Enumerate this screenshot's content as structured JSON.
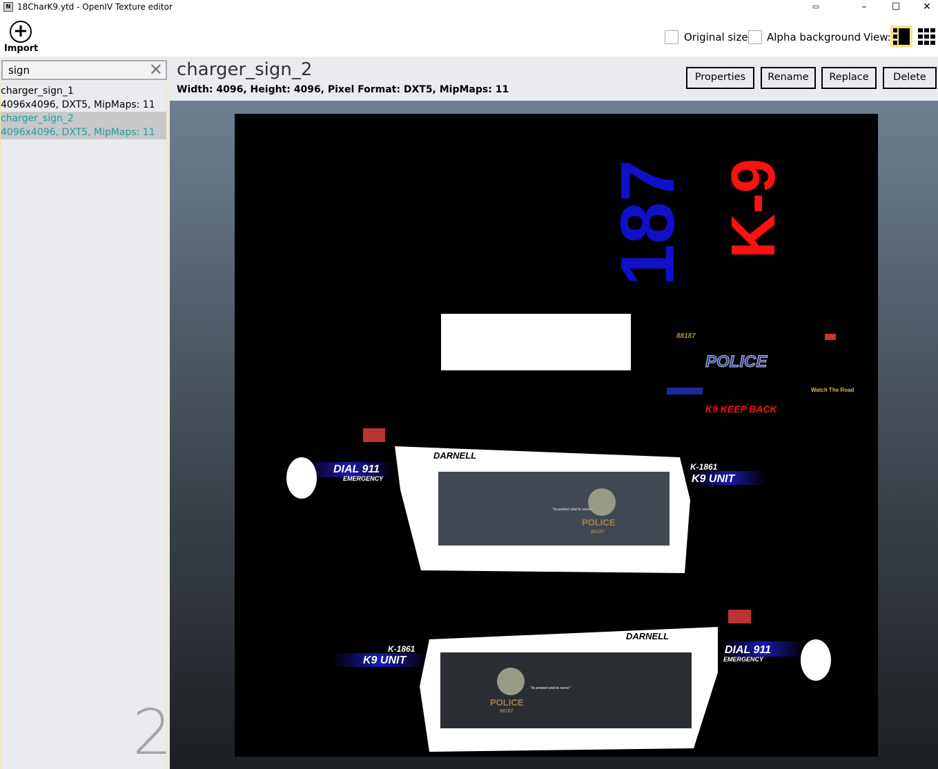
{
  "window": {
    "title": "18CharK9.ytd - OpenIV Texture editor",
    "icon": "openiv-icon",
    "controls": [
      "minimize",
      "maximize",
      "close"
    ]
  },
  "toolbar": {
    "import_label": "Import",
    "original_size_label": "Original size",
    "original_size_checked": false,
    "alpha_background_label": "Alpha background",
    "alpha_background_checked": false,
    "view_label": "View:",
    "view_modes": [
      "single-view",
      "grid-view"
    ],
    "active_view": "single-view",
    "accent": "#f3e58f"
  },
  "search": {
    "value": "sign",
    "placeholder": ""
  },
  "list": {
    "items": [
      {
        "name": "charger_sign_1",
        "info": "4096x4096, DXT5, MipMaps: 11",
        "selected": false
      },
      {
        "name": "charger_sign_2",
        "info": "4096x4096, DXT5, MipMaps: 11",
        "selected": true
      }
    ],
    "count": "2",
    "selected_color": "#279a9c"
  },
  "texture": {
    "name": "charger_sign_2",
    "info": "Width: 4096, Height: 4096, Pixel Format: DXT5, MipMaps: 11",
    "content": {
      "number": "187",
      "k9": "K-9",
      "unit_no": "88187",
      "police": "POLICE",
      "keep_back": "K9 KEEP BACK",
      "watch": "Watch The Road",
      "darnell": "DARNELL",
      "dial": "DIAL 911",
      "emergency": "EMERGENCY",
      "k_no": "K-1861",
      "k9_unit": "K9 UNIT",
      "seal_text": "POLICE",
      "seal_no": "88187",
      "motto": "\"to protect and to serve\""
    }
  },
  "actions": {
    "properties": "Properties",
    "rename": "Rename",
    "replace": "Replace",
    "delete": "Delete"
  }
}
